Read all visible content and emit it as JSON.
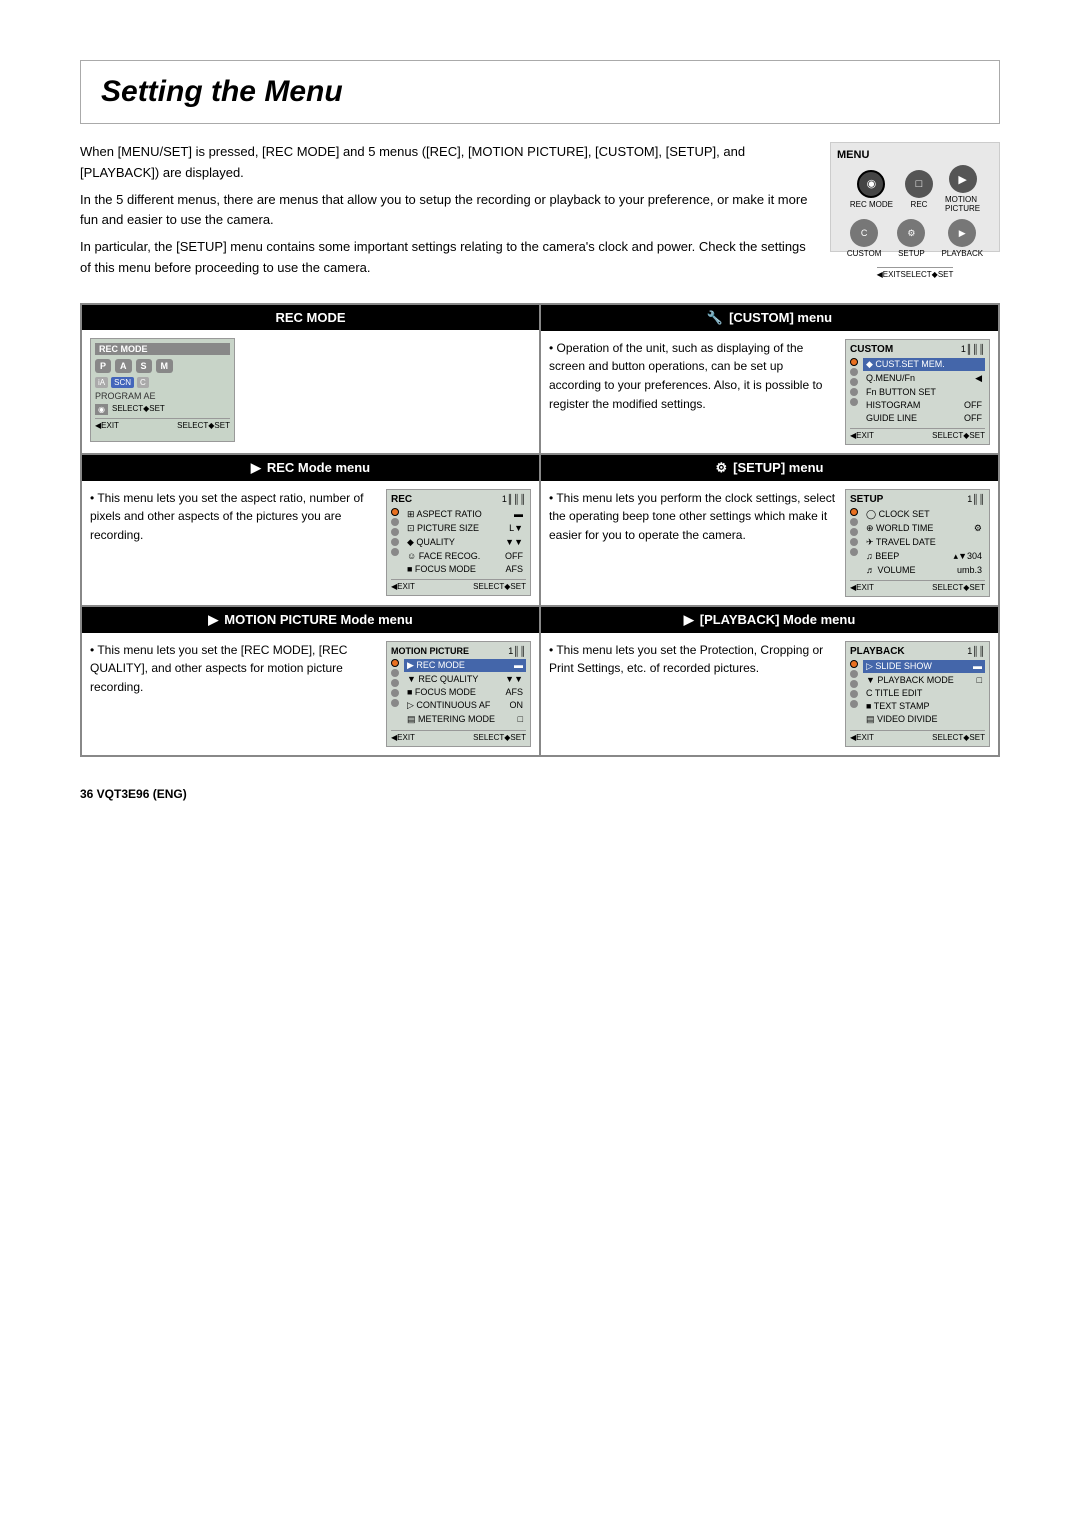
{
  "page": {
    "title": "Setting the Menu",
    "footer": "36  VQT3E96 (ENG)"
  },
  "intro": {
    "para1": "When [MENU/SET] is pressed, [REC MODE] and 5 menus ([REC], [MOTION PICTURE], [CUSTOM], [SETUP], and [PLAYBACK]) are displayed.",
    "para2": "In the 5 different menus, there are menus that allow you to setup the recording or playback to your preference, or make it more fun and easier to use the camera.",
    "para3": "In particular, the [SETUP] menu contains some important settings relating to the camera's clock and power. Check the settings of this menu before proceeding to use the camera."
  },
  "sections": {
    "rec_mode": {
      "header": "REC MODE",
      "text": ""
    },
    "custom": {
      "header": "[CUSTOM] menu",
      "text": "• Operation of the unit, such as displaying of the screen and button operations, can be set up according to your preferences. Also, it is possible to register the modified settings."
    },
    "rec_mode_menu": {
      "header": "REC Mode menu",
      "text": "• This menu lets you set the aspect ratio, number of pixels and other aspects of the pictures you are recording."
    },
    "setup": {
      "header": "[SETUP] menu",
      "text": "• This menu lets you perform the clock settings, select the operating beep tone other settings which make it easier for you to operate the camera."
    },
    "motion_picture": {
      "header": "MOTION PICTURE Mode menu",
      "text": "• This menu lets you set the [REC MODE], [REC QUALITY], and other aspects for motion picture recording."
    },
    "playback": {
      "header": "[PLAYBACK] Mode menu",
      "text": "• This menu lets you set the Protection, Cropping or Print Settings, etc. of recorded pictures."
    }
  },
  "cam_ui": {
    "menu_label": "MENU",
    "rec_mode_label": "REC MODE",
    "rec_mode_title": "REC MODE",
    "rec_buttons": [
      "P",
      "A",
      "S",
      "M"
    ],
    "rec_sub_buttons": [
      "iA",
      "SCN",
      "C"
    ],
    "program_ae": "PROGRAM AE",
    "exit": "EXIT",
    "select_set": "SELECT SET",
    "custom_title": "CUSTOM",
    "custom_page": "1",
    "custom_items": [
      {
        "icon": "●",
        "label": "CUST.SET MEM.",
        "value": "",
        "highlight": true
      },
      {
        "icon": "●",
        "label": "Q.MENU/Fn",
        "value": ""
      },
      {
        "icon": "C",
        "label": "Fn BUTTON SET",
        "value": ""
      },
      {
        "icon": "↑",
        "label": "HISTOGRAM",
        "value": "OFF"
      },
      {
        "icon": "→",
        "label": "GUIDE LINE",
        "value": "OFF"
      }
    ],
    "rec_menu_title": "REC",
    "rec_menu_page": "1",
    "rec_menu_items": [
      {
        "icon": "⊞",
        "label": "ASPECT RATIO",
        "value": ""
      },
      {
        "icon": "⊡",
        "label": "PICTURE SIZE",
        "value": "L"
      },
      {
        "icon": "◆",
        "label": "QUALITY",
        "value": ""
      },
      {
        "icon": "☺",
        "label": "FACE RECOG.",
        "value": "OFF"
      },
      {
        "icon": "▣",
        "label": "FOCUS MODE",
        "value": "AFS"
      }
    ],
    "setup_title": "SETUP",
    "setup_page": "1",
    "setup_items": [
      {
        "icon": "◷",
        "label": "CLOCK SET",
        "value": ""
      },
      {
        "icon": "⊕",
        "label": "WORLD TIME",
        "value": ""
      },
      {
        "icon": "✈",
        "label": "TRAVEL DATE",
        "value": ""
      },
      {
        "icon": "♪",
        "label": "BEEP",
        "value": "304"
      },
      {
        "icon": "◉",
        "label": "VOLUME",
        "value": "umb.3"
      }
    ],
    "motion_title": "MOTION PICTURE",
    "motion_page": "1",
    "motion_items": [
      {
        "icon": "⊞",
        "label": "REC MODE",
        "value": "",
        "highlight": true
      },
      {
        "icon": "⊡",
        "label": "REC QUALITY",
        "value": ""
      },
      {
        "icon": "▣",
        "label": "FOCUS MODE",
        "value": "AFS"
      },
      {
        "icon": "◆",
        "label": "CONTINUOUS AF",
        "value": "ON"
      },
      {
        "icon": "⊠",
        "label": "METERING MODE",
        "value": ""
      }
    ],
    "playback_title": "PLAYBACK",
    "playback_page": "1",
    "playback_items": [
      {
        "icon": "⊡",
        "label": "SLIDE SHOW",
        "value": "",
        "highlight": true
      },
      {
        "icon": "◆",
        "label": "PLAYBACK MODE",
        "value": ""
      },
      {
        "icon": "C",
        "label": "TITLE EDIT",
        "value": ""
      },
      {
        "icon": "▣",
        "label": "TEXT STAMP",
        "value": ""
      },
      {
        "icon": "⊞",
        "label": "VIDEO DIVIDE",
        "value": ""
      }
    ]
  }
}
